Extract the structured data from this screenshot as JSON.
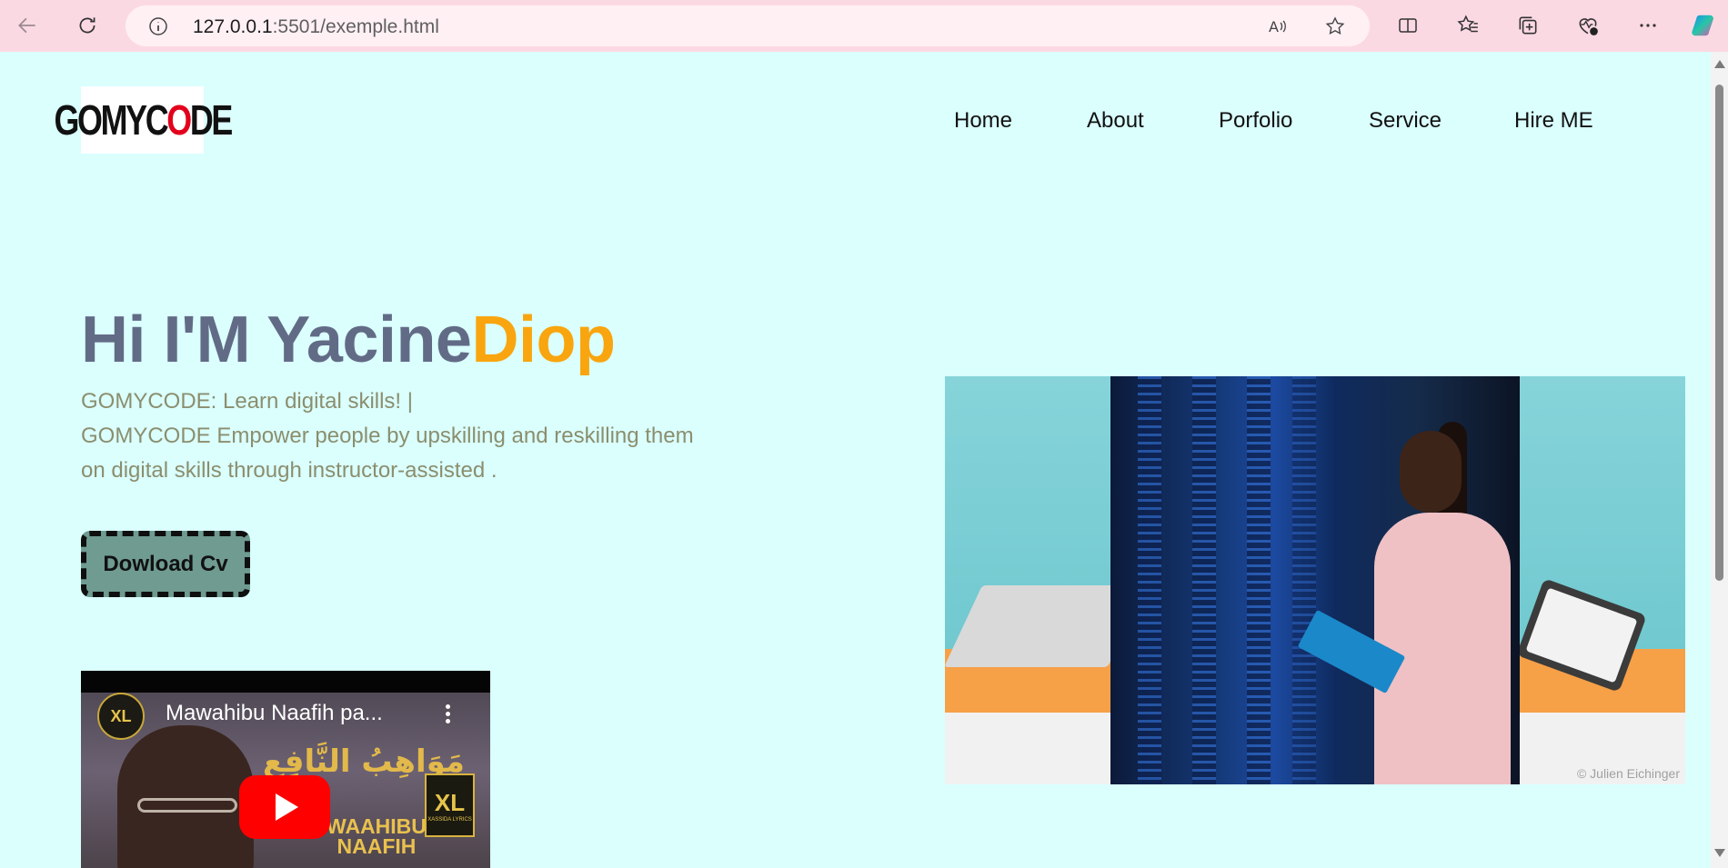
{
  "browser": {
    "url_host": "127.0.0.1",
    "url_rest": ":5501/exemple.html"
  },
  "header": {
    "logo_text_1": "GOMYC",
    "logo_text_o": "O",
    "logo_text_2": "DE",
    "nav": [
      "Home",
      "About",
      "Porfolio",
      "Service",
      "Hire ME"
    ]
  },
  "hero": {
    "title_main": "Hi I'M Yacine",
    "title_accent": "Diop",
    "desc_line1": "GOMYCODE: Learn digital skills! |",
    "desc_line2": "GOMYCODE Empower people by upskilling and reskilling them",
    "desc_line3": "on digital skills through instructor-assisted .",
    "cv_button": "Dowload Cv"
  },
  "video": {
    "title": "Mawahibu Naafih pa...",
    "channel_badge": "XL",
    "arabic_text": "مَوَاهِبُ النَّافِعِ",
    "art_line1": "WAAHIBU",
    "art_line2": "NAAFIH",
    "badge_big": "XL",
    "badge_small": "XASSIDA LYRICS"
  },
  "hero_image": {
    "credit": "© Julien Eichinger"
  },
  "colors": {
    "page_bg": "#dafffd",
    "title_color": "#626b86",
    "accent": "#f9a50f",
    "button_bg": "#6f9b91",
    "browser_bar": "#fbd9e3"
  }
}
